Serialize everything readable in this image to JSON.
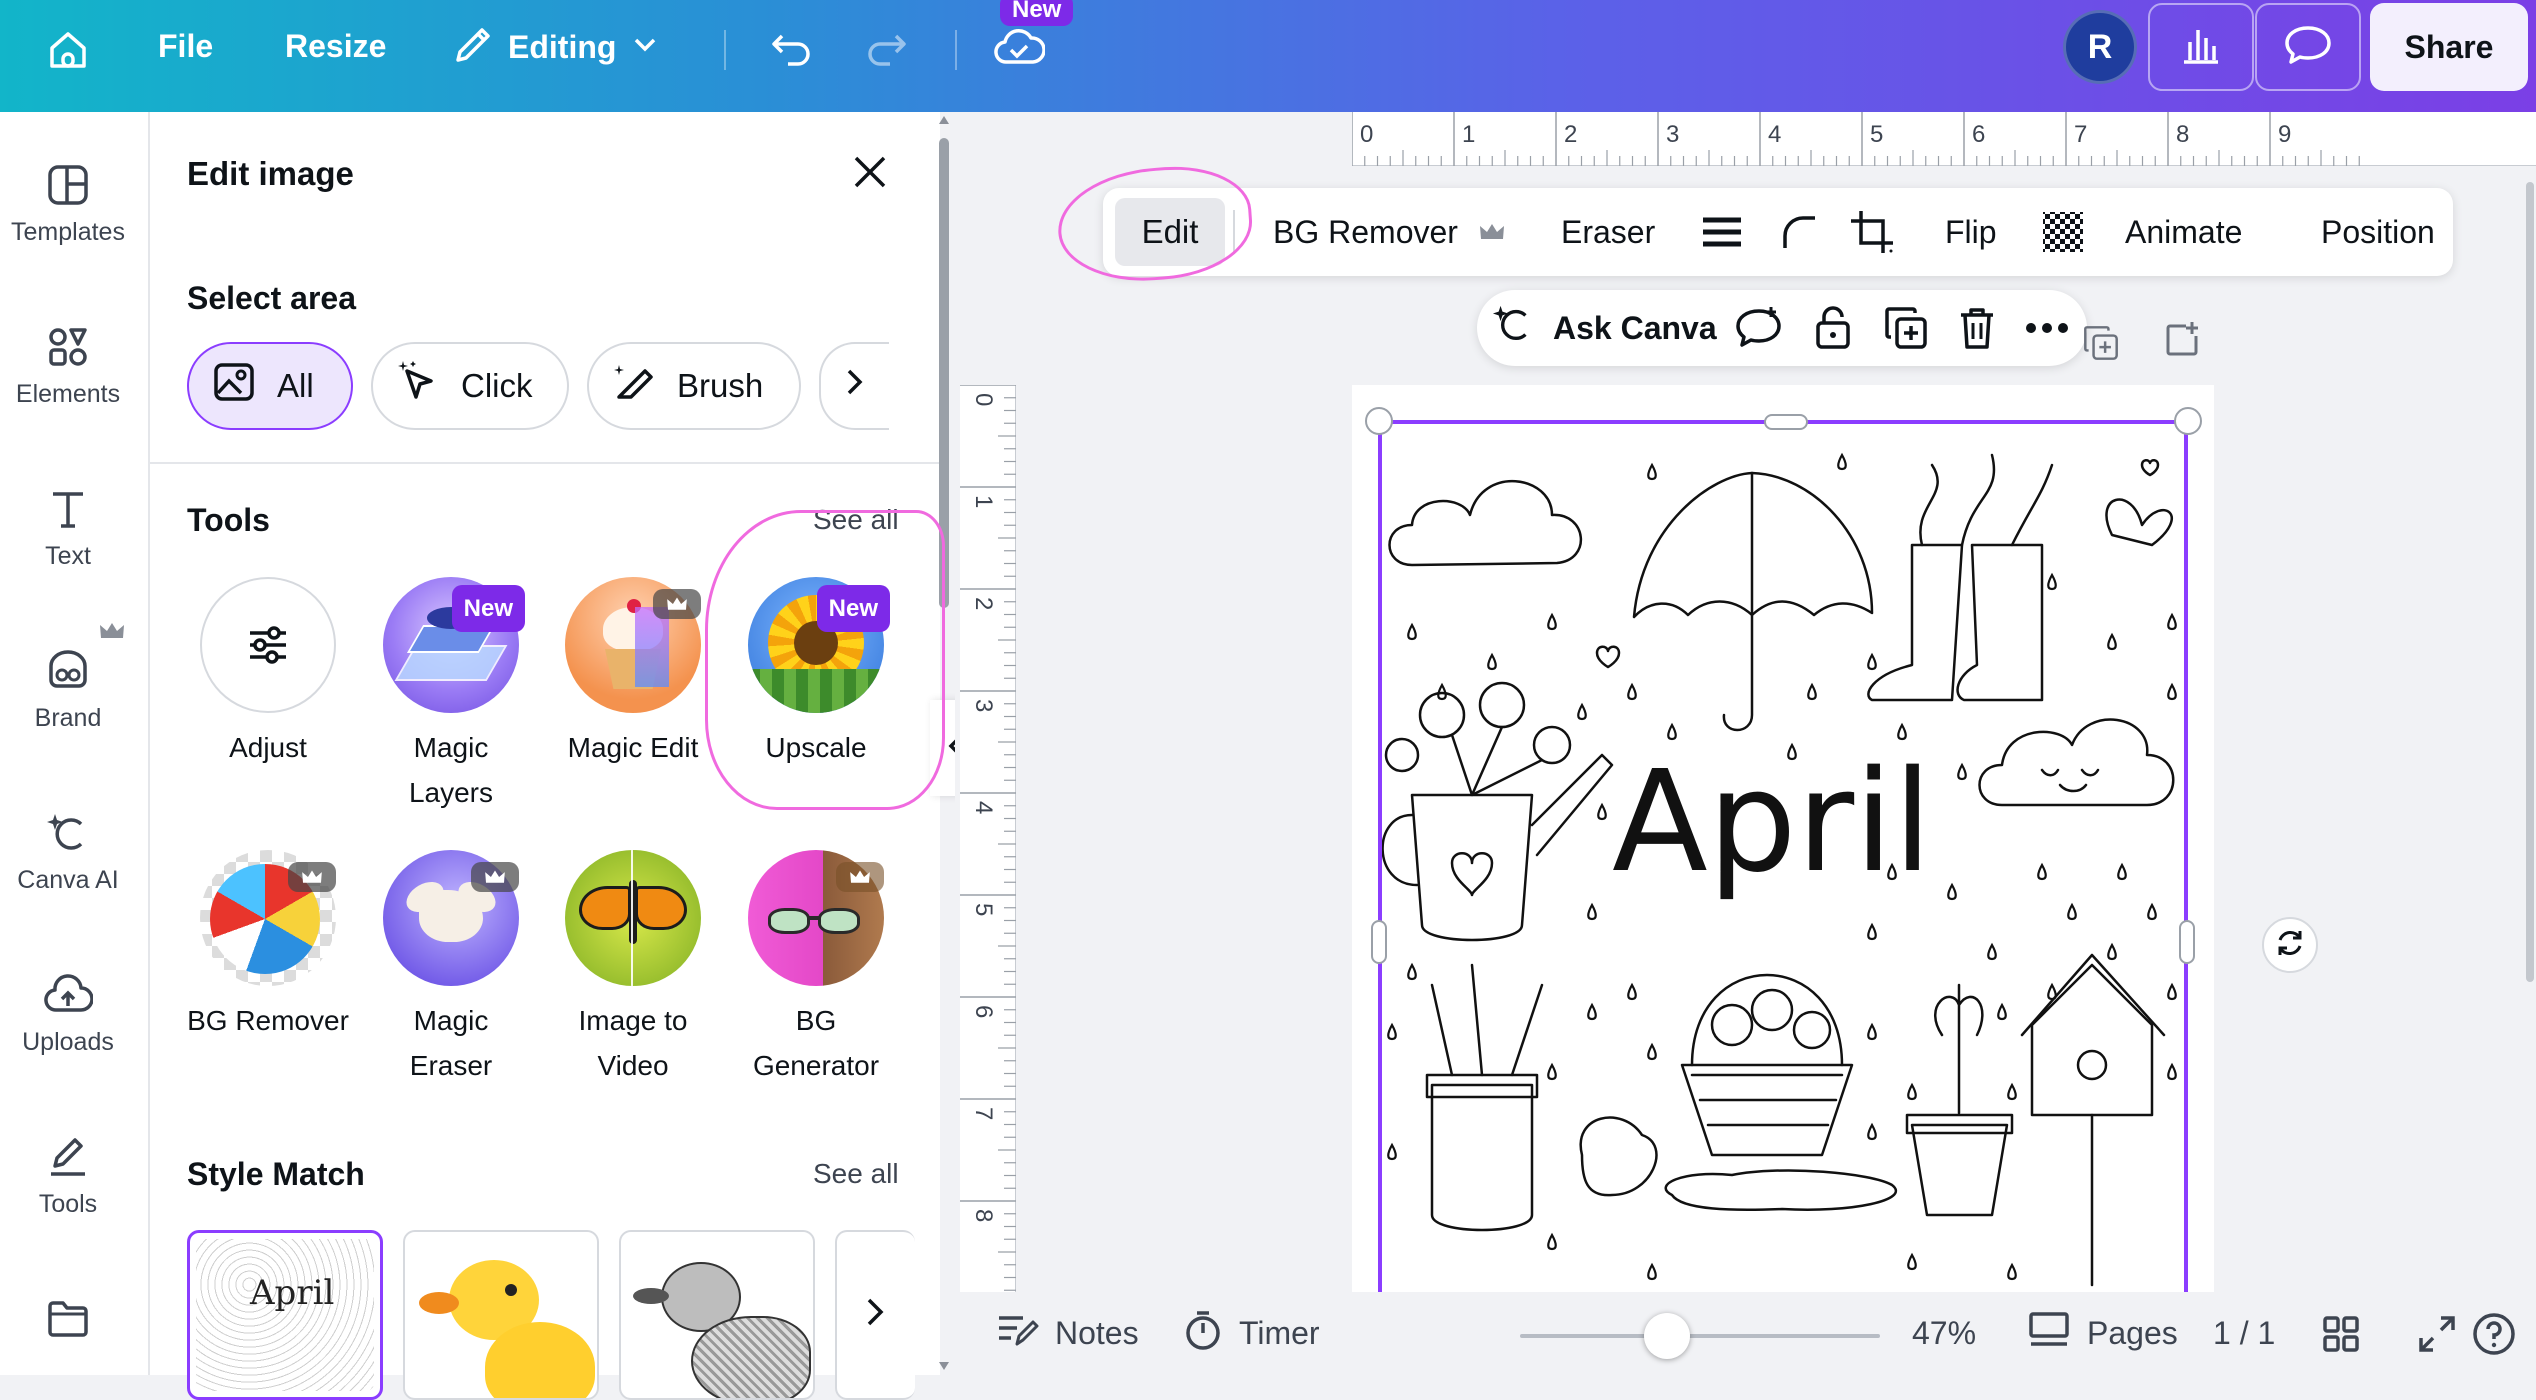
{
  "topbar": {
    "file": "File",
    "resize": "Resize",
    "editing": "Editing",
    "new_badge": "New",
    "avatar_initial": "R",
    "share": "Share"
  },
  "leftnav": {
    "items": [
      {
        "label": "Templates",
        "icon": "templates-icon"
      },
      {
        "label": "Elements",
        "icon": "elements-icon"
      },
      {
        "label": "Text",
        "icon": "text-icon"
      },
      {
        "label": "Brand",
        "icon": "brand-icon"
      },
      {
        "label": "Canva AI",
        "icon": "canva-ai-icon"
      },
      {
        "label": "Uploads",
        "icon": "uploads-icon"
      },
      {
        "label": "Tools",
        "icon": "tools-icon"
      },
      {
        "label": "",
        "icon": "projects-folder-icon"
      }
    ]
  },
  "panel": {
    "title": "Edit image",
    "select_area": "Select area",
    "select_options": [
      "All",
      "Click",
      "Brush"
    ],
    "tools_title": "Tools",
    "tools_see_all": "See all",
    "tools": [
      {
        "label1": "Adjust",
        "label2": ""
      },
      {
        "label1": "Magic",
        "label2": "Layers",
        "badge": "New"
      },
      {
        "label1": "Magic Edit",
        "label2": ""
      },
      {
        "label1": "Upscale",
        "label2": "",
        "badge": "New"
      },
      {
        "label1": "BG Remover",
        "label2": ""
      },
      {
        "label1": "Magic",
        "label2": "Eraser"
      },
      {
        "label1": "Image to",
        "label2": "Video"
      },
      {
        "label1": "BG",
        "label2": "Generator"
      }
    ],
    "style_match_title": "Style Match",
    "style_match_see_all": "See all",
    "thumb_april": "April"
  },
  "ruler": {
    "top": [
      "0",
      "1",
      "2",
      "3",
      "4",
      "5",
      "6",
      "7",
      "8",
      "9"
    ],
    "left": [
      "0",
      "1",
      "2",
      "3",
      "4",
      "5",
      "6",
      "7",
      "8"
    ]
  },
  "context_toolbar": {
    "edit": "Edit",
    "bg_remover": "BG Remover",
    "eraser": "Eraser",
    "flip": "Flip",
    "animate": "Animate",
    "position": "Position"
  },
  "ask_bar": {
    "ask_canva": "Ask Canva"
  },
  "canvas": {
    "title_word": "April"
  },
  "bottombar": {
    "notes": "Notes",
    "timer": "Timer",
    "zoom": "47%",
    "zoom_level": 0.47,
    "pages": "Pages",
    "page_count": "1 / 1"
  },
  "colors": {
    "accent": "#8b3dff",
    "badge": "#7d2ae8",
    "highlight": "#f06adf"
  }
}
